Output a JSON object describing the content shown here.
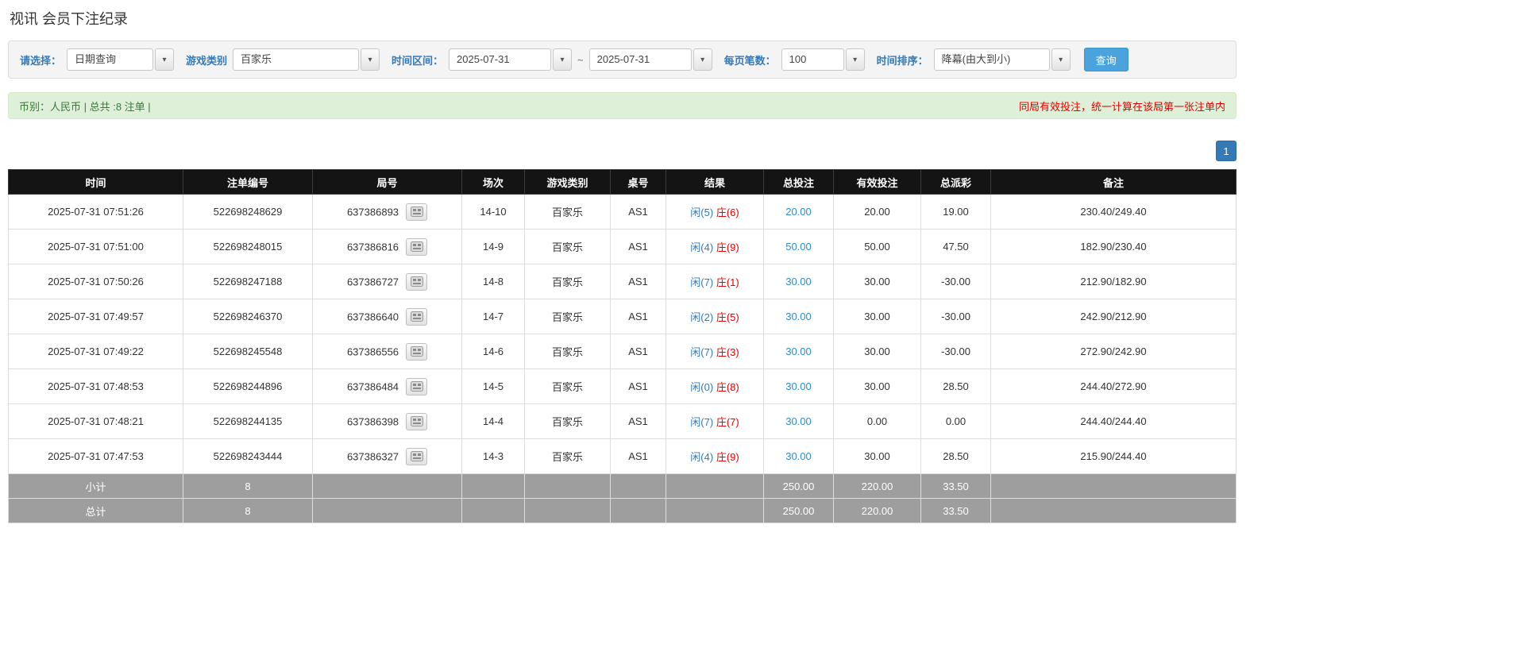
{
  "page": {
    "title": "视讯 会员下注纪录"
  },
  "colors": {
    "accent_blue": "#337ab7",
    "link_blue": "#2d8dd8",
    "alert_red": "#e60000",
    "green_bg": "#dff0d8",
    "green_text": "#3c763d",
    "header_bg": "#141414",
    "footer_bg": "#9e9e9e",
    "button_blue": "#4aa3dc"
  },
  "icons": {
    "chevron_down": "▾",
    "round_record_icon": "round-record-grid"
  },
  "filters": {
    "select_label": "请选择：",
    "select_value": "日期查询",
    "game_type_label": "游戏类别",
    "game_type_value": "百家乐",
    "time_range_label": "时间区间：",
    "date_from": "2025-07-31",
    "date_separator": "~",
    "date_to": "2025-07-31",
    "page_size_label": "每页笔数：",
    "page_size_value": "100",
    "sort_label": "时间排序：",
    "sort_value": "降幕(由大到小)",
    "search_button": "查询"
  },
  "summary": {
    "left": "币别：人民币 | 总共 :8 注单 |",
    "right": "同局有效投注，统一计算在该局第一张注单内"
  },
  "pagination": {
    "current": "1"
  },
  "table": {
    "headers": [
      "时间",
      "注单编号",
      "局号",
      "场次",
      "游戏类别",
      "桌号",
      "结果",
      "总投注",
      "有效投注",
      "总派彩",
      "备注"
    ],
    "rows": [
      {
        "time": "2025-07-31 07:51:26",
        "bet_id": "522698248629",
        "round_id": "637386893",
        "session": "14-10",
        "game_type": "百家乐",
        "table_no": "AS1",
        "result_player": "闲(5)",
        "result_banker": "庄(6)",
        "total_bet": "20.00",
        "valid_bet": "20.00",
        "payout": "19.00",
        "remark": "230.40/249.40"
      },
      {
        "time": "2025-07-31 07:51:00",
        "bet_id": "522698248015",
        "round_id": "637386816",
        "session": "14-9",
        "game_type": "百家乐",
        "table_no": "AS1",
        "result_player": "闲(4)",
        "result_banker": "庄(9)",
        "total_bet": "50.00",
        "valid_bet": "50.00",
        "payout": "47.50",
        "remark": "182.90/230.40"
      },
      {
        "time": "2025-07-31 07:50:26",
        "bet_id": "522698247188",
        "round_id": "637386727",
        "session": "14-8",
        "game_type": "百家乐",
        "table_no": "AS1",
        "result_player": "闲(7)",
        "result_banker": "庄(1)",
        "total_bet": "30.00",
        "valid_bet": "30.00",
        "payout": "-30.00",
        "remark": "212.90/182.90"
      },
      {
        "time": "2025-07-31 07:49:57",
        "bet_id": "522698246370",
        "round_id": "637386640",
        "session": "14-7",
        "game_type": "百家乐",
        "table_no": "AS1",
        "result_player": "闲(2)",
        "result_banker": "庄(5)",
        "total_bet": "30.00",
        "valid_bet": "30.00",
        "payout": "-30.00",
        "remark": "242.90/212.90"
      },
      {
        "time": "2025-07-31 07:49:22",
        "bet_id": "522698245548",
        "round_id": "637386556",
        "session": "14-6",
        "game_type": "百家乐",
        "table_no": "AS1",
        "result_player": "闲(7)",
        "result_banker": "庄(3)",
        "total_bet": "30.00",
        "valid_bet": "30.00",
        "payout": "-30.00",
        "remark": "272.90/242.90"
      },
      {
        "time": "2025-07-31 07:48:53",
        "bet_id": "522698244896",
        "round_id": "637386484",
        "session": "14-5",
        "game_type": "百家乐",
        "table_no": "AS1",
        "result_player": "闲(0)",
        "result_banker": "庄(8)",
        "total_bet": "30.00",
        "valid_bet": "30.00",
        "payout": "28.50",
        "remark": "244.40/272.90"
      },
      {
        "time": "2025-07-31 07:48:21",
        "bet_id": "522698244135",
        "round_id": "637386398",
        "session": "14-4",
        "game_type": "百家乐",
        "table_no": "AS1",
        "result_player": "闲(7)",
        "result_banker": "庄(7)",
        "total_bet": "30.00",
        "valid_bet": "0.00",
        "payout": "0.00",
        "remark": "244.40/244.40"
      },
      {
        "time": "2025-07-31 07:47:53",
        "bet_id": "522698243444",
        "round_id": "637386327",
        "session": "14-3",
        "game_type": "百家乐",
        "table_no": "AS1",
        "result_player": "闲(4)",
        "result_banker": "庄(9)",
        "total_bet": "30.00",
        "valid_bet": "30.00",
        "payout": "28.50",
        "remark": "215.90/244.40"
      }
    ],
    "subtotal": {
      "label": "小计",
      "count": "8",
      "total_bet": "250.00",
      "valid_bet": "220.00",
      "payout": "33.50"
    },
    "total": {
      "label": "总计",
      "count": "8",
      "total_bet": "250.00",
      "valid_bet": "220.00",
      "payout": "33.50"
    }
  }
}
